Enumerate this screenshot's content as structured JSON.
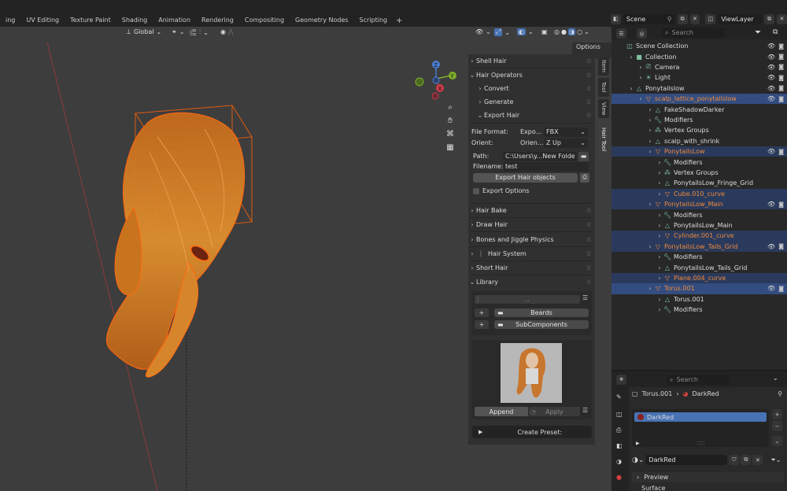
{
  "workspace_tabs": [
    "ing",
    "UV Editing",
    "Texture Paint",
    "Shading",
    "Animation",
    "Rendering",
    "Compositing",
    "Geometry Nodes",
    "Scripting"
  ],
  "scene": "Scene",
  "view_layer": "ViewLayer",
  "viewport": {
    "transform_orientation": "Global",
    "options_label": "Options"
  },
  "npanel": {
    "shell_hair": "Shell Hair",
    "hair_operators": "Hair Operators",
    "convert": "Convert",
    "generate": "Generate",
    "export_hair": "Export Hair",
    "file_format_label": "File Format:",
    "file_format_short": "Expo...",
    "file_format_value": "FBX",
    "orient_label": "Orient:",
    "orient_short": "Orien...",
    "orient_value": "Z Up",
    "path_label": "Path:",
    "path_value": "C:\\Users\\y...New Folder\\",
    "filename_label": "Filename:",
    "filename_value": "test",
    "export_button": "Export Hair objects",
    "export_options": "Export Options",
    "hair_bake": "Hair Bake",
    "draw_hair": "Draw Hair",
    "bones": "Bones and Jiggle Physics",
    "hair_system": "Hair System",
    "short_hair": "Short Hair",
    "library": "Library",
    "lib_path": "..",
    "folders": [
      "Beards",
      "SubComponents"
    ],
    "append": "Append",
    "apply": "Apply",
    "create_preset": "Create Preset:"
  },
  "side_tabs": [
    "Item",
    "Tool",
    "View",
    "Hair Tool"
  ],
  "outliner": {
    "search_placeholder": "Search",
    "rows": [
      {
        "name": "Scene Collection",
        "indent": 0,
        "style": "plain"
      },
      {
        "name": "Collection",
        "indent": 1,
        "style": "plain"
      },
      {
        "name": "Camera",
        "indent": 2,
        "style": "plain"
      },
      {
        "name": "Light",
        "indent": 2,
        "style": "plain"
      },
      {
        "name": "Ponytailslow",
        "indent": 1,
        "style": "plain"
      },
      {
        "name": "scalp_lattice_ponytailslow",
        "indent": 2,
        "style": "sel",
        "orange": true
      },
      {
        "name": "FakeShadowDarker",
        "indent": 3,
        "style": "plain"
      },
      {
        "name": "Modifiers",
        "indent": 3,
        "style": "plain"
      },
      {
        "name": "Vertex Groups",
        "indent": 3,
        "style": "plain"
      },
      {
        "name": "scalp_with_shrink",
        "indent": 3,
        "style": "plain"
      },
      {
        "name": "PonytailsLow",
        "indent": 3,
        "style": "sel2",
        "orange": true
      },
      {
        "name": "Modifiers",
        "indent": 4,
        "style": "plain"
      },
      {
        "name": "Vertex Groups",
        "indent": 4,
        "style": "plain"
      },
      {
        "name": "PonytailsLow_Fringe_Grid",
        "indent": 4,
        "style": "plain"
      },
      {
        "name": "Cube.010_curve",
        "indent": 4,
        "style": "sel2",
        "orange": true
      },
      {
        "name": "PonytailsLow_Main",
        "indent": 3,
        "style": "sel2",
        "orange": true
      },
      {
        "name": "Modifiers",
        "indent": 4,
        "style": "plain"
      },
      {
        "name": "PonytailsLow_Main",
        "indent": 4,
        "style": "plain"
      },
      {
        "name": "Cylinder.001_curve",
        "indent": 4,
        "style": "sel2",
        "orange": true
      },
      {
        "name": "PonytailsLow_Tails_Grid",
        "indent": 3,
        "style": "sel2",
        "orange": true
      },
      {
        "name": "Modifiers",
        "indent": 4,
        "style": "plain"
      },
      {
        "name": "PonytailsLow_Tails_Grid",
        "indent": 4,
        "style": "plain"
      },
      {
        "name": "Plane.004_curve",
        "indent": 4,
        "style": "sel2",
        "orange": true
      },
      {
        "name": "Torus.001",
        "indent": 3,
        "style": "sel",
        "orange": true
      },
      {
        "name": "Torus.001",
        "indent": 4,
        "style": "plain"
      },
      {
        "name": "Modifiers",
        "indent": 4,
        "style": "plain"
      }
    ]
  },
  "properties": {
    "search_placeholder": "Search",
    "object": "Torus.001",
    "material": "DarkRed",
    "slot_name": "DarkRed",
    "material_field": "DarkRed",
    "preview": "Preview",
    "surface_partial": "Surface"
  },
  "colors": {
    "accent_blue": "#4772b3",
    "orange": "#f08a3c"
  }
}
